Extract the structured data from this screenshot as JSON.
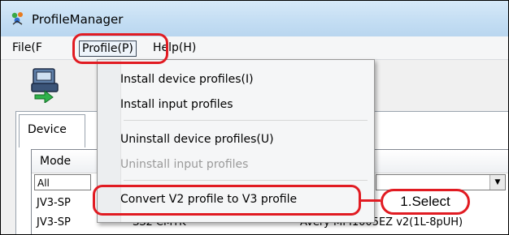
{
  "window": {
    "title": "ProfileManager"
  },
  "menubar": {
    "file": "File(F",
    "profile": "Profile(P)",
    "help": "Help(H)"
  },
  "tabs": {
    "device": "Device"
  },
  "list": {
    "column_model": "Mode",
    "filter_all": "All",
    "rows": [
      {
        "model": "JV3-SP",
        "detail": ""
      },
      {
        "model": "JV3-SP",
        "ink": "SS2 CMYK",
        "media": "Avery MPI1005EZ v2(1L-8pUH)"
      }
    ]
  },
  "profile_menu": {
    "items": [
      {
        "label": "Install device profiles(I)",
        "enabled": true
      },
      {
        "label": "Install input profiles",
        "enabled": true
      },
      {
        "label": "Uninstall device profiles(U)",
        "enabled": true
      },
      {
        "label": "Uninstall input profiles",
        "enabled": false
      },
      {
        "label": "Convert V2 profile to V3 profile",
        "enabled": true
      }
    ]
  },
  "annotation": {
    "callout": "1.Select",
    "color": "#e11b22"
  }
}
